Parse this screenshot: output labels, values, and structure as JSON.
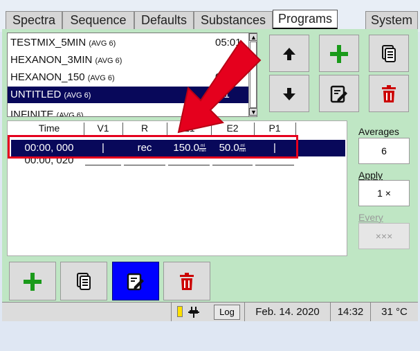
{
  "tabs": [
    {
      "label": "Spectra"
    },
    {
      "label": "Sequence"
    },
    {
      "label": "Defaults"
    },
    {
      "label": "Substances"
    },
    {
      "label": "Programs"
    },
    {
      "label": "System"
    }
  ],
  "active_tab": "Programs",
  "programs": [
    {
      "name": "TESTMIX_5MIN",
      "avg": "(AVG 6)",
      "time": "05:01"
    },
    {
      "name": "HEXANON_3MIN",
      "avg": "(AVG 6)",
      "time": ""
    },
    {
      "name": "HEXANON_150",
      "avg": "(AVG 6)",
      "time": "01"
    },
    {
      "name": "UNTITLED",
      "avg": "(AVG 6)",
      "time": ":01"
    },
    {
      "name": "INFINITE",
      "avg": "(AVG 6)",
      "time": ""
    }
  ],
  "program_buttons": {
    "up": "up-arrow",
    "add": "plus",
    "copy": "copy",
    "down": "down-arrow",
    "edit": "edit",
    "delete": "trash"
  },
  "table": {
    "headers": [
      "Time",
      "V1",
      "R",
      "E1",
      "E2",
      "P1"
    ],
    "rows": [
      {
        "time": "00:00, 000",
        "v1": "|",
        "r": "rec",
        "e1": "150.0",
        "e2": "50.0",
        "p1": "|",
        "unit_top": "ml",
        "unit_bottom": "min"
      },
      {
        "time": "00:00, 020"
      }
    ]
  },
  "controls": {
    "averages_label": "Averages",
    "averages_value": "6",
    "apply_label": "Apply",
    "apply_value": "1 ×",
    "every_label": "Every",
    "every_value": "×××"
  },
  "status": {
    "log": "Log",
    "date": "Feb. 14. 2020",
    "time": "14:32",
    "temp": "31 °C"
  },
  "colors": {
    "selection": "#08085a",
    "panel_green": "#bfe6c4",
    "highlight_red": "#e5001d",
    "active_blue": "#0000ff",
    "plus_green": "#1a9a1a",
    "trash_red": "#cc0000"
  }
}
